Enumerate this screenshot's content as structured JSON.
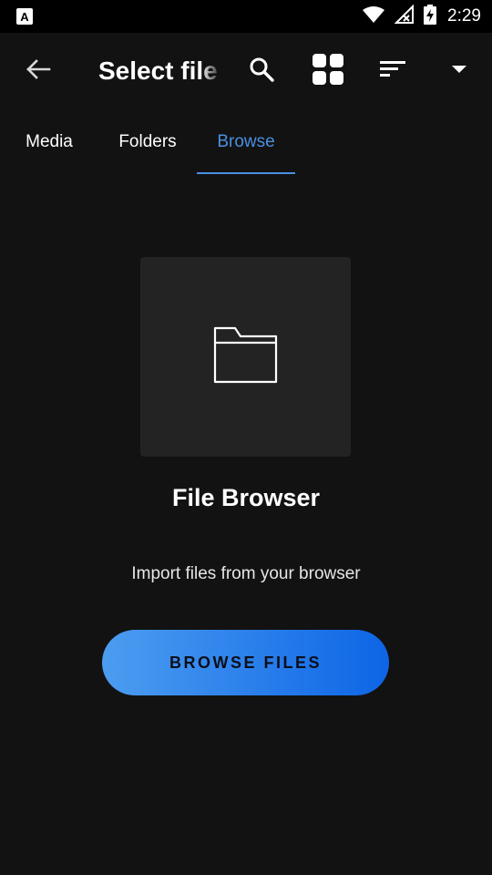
{
  "status_bar": {
    "time": "2:29",
    "icons": [
      "app-a-icon",
      "wifi-icon",
      "signal-off-icon",
      "battery-charging-icon"
    ]
  },
  "toolbar": {
    "title": "Select files",
    "icons": [
      "back-arrow-icon",
      "search-icon",
      "grid-view-icon",
      "sort-icon",
      "dropdown-arrow-icon"
    ]
  },
  "tabs": [
    {
      "label": "Media",
      "active": false
    },
    {
      "label": "Folders",
      "active": false
    },
    {
      "label": "Browse",
      "active": true
    }
  ],
  "empty_state": {
    "icon": "folder-icon",
    "title": "File Browser",
    "subtitle": "Import files from your browser",
    "button_label": "BROWSE FILES"
  },
  "colors": {
    "background": "#121212",
    "status_bar": "#000000",
    "accent": "#4a90e2",
    "tile": "#232323",
    "button_gradient_start": "#4c9df0",
    "button_gradient_end": "#0d65e6"
  }
}
